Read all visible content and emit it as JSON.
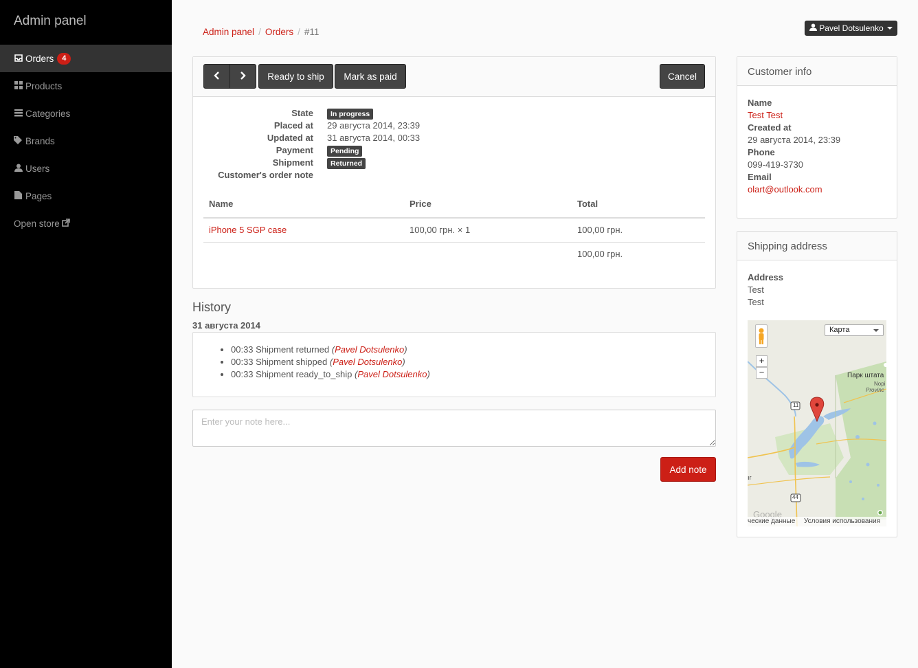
{
  "sidebar": {
    "brand": "Admin panel",
    "items": [
      {
        "label": "Orders",
        "icon": "inbox-icon",
        "badge": "4",
        "active": true
      },
      {
        "label": "Products",
        "icon": "grid-icon"
      },
      {
        "label": "Categories",
        "icon": "list-icon"
      },
      {
        "label": "Brands",
        "icon": "tags-icon"
      },
      {
        "label": "Users",
        "icon": "user-icon"
      },
      {
        "label": "Pages",
        "icon": "file-icon"
      },
      {
        "label": "Open store",
        "icon": "external-link-icon"
      }
    ]
  },
  "breadcrumb": {
    "items": [
      "Admin panel",
      "Orders",
      "#11"
    ]
  },
  "user_menu": {
    "label": "Pavel Dotsulenko"
  },
  "toolbar": {
    "ready_label": "Ready to ship",
    "paid_label": "Mark as paid",
    "cancel_label": "Cancel"
  },
  "order": {
    "fields": {
      "state_label": "State",
      "state_value": "In progress",
      "placed_label": "Placed at",
      "placed_value": "29 августа 2014, 23:39",
      "updated_label": "Updated at",
      "updated_value": "31 августа 2014, 00:33",
      "payment_label": "Payment",
      "payment_value": "Pending",
      "shipment_label": "Shipment",
      "shipment_value": "Returned",
      "note_label": "Customer's order note"
    },
    "table": {
      "headers": [
        "Name",
        "Price",
        "Total"
      ],
      "rows": [
        {
          "name": "iPhone 5 SGP case",
          "price": "100,00 грн. × 1",
          "total": "100,00 грн."
        }
      ],
      "grand_total": "100,00 грн."
    }
  },
  "history": {
    "title": "History",
    "date": "31 августа 2014",
    "entries": [
      {
        "text": "00:33 Shipment returned",
        "user": "Pavel Dotsulenko"
      },
      {
        "text": "00:33 Shipment shipped",
        "user": "Pavel Dotsulenko"
      },
      {
        "text": "00:33 Shipment ready_to_ship",
        "user": "Pavel Dotsulenko"
      }
    ]
  },
  "note": {
    "placeholder": "Enter your note here...",
    "button_label": "Add note"
  },
  "customer": {
    "title": "Customer info",
    "name_label": "Name",
    "name_value": "Test Test",
    "created_label": "Created at",
    "created_value": "29 августа 2014, 23:39",
    "phone_label": "Phone",
    "phone_value": "099-419-3730",
    "email_label": "Email",
    "email_value": "olart@outlook.com"
  },
  "shipping": {
    "title": "Shipping address",
    "address_label": "Address",
    "address_lines": [
      "Test",
      "Test"
    ],
    "map": {
      "type_label": "Карта",
      "footer_left": "ческие данные",
      "footer_right": "Условия использования",
      "label_park": "Парк штата",
      "label_prov": "Nopi",
      "label_prov2": "Provinc",
      "road_1": "11",
      "road_2": "44",
      "fragment": "ır",
      "watermark": "Google"
    }
  },
  "colors": {
    "accent": "#cc1f16",
    "sidebar_bg": "#000000",
    "dark_button": "#444444"
  }
}
